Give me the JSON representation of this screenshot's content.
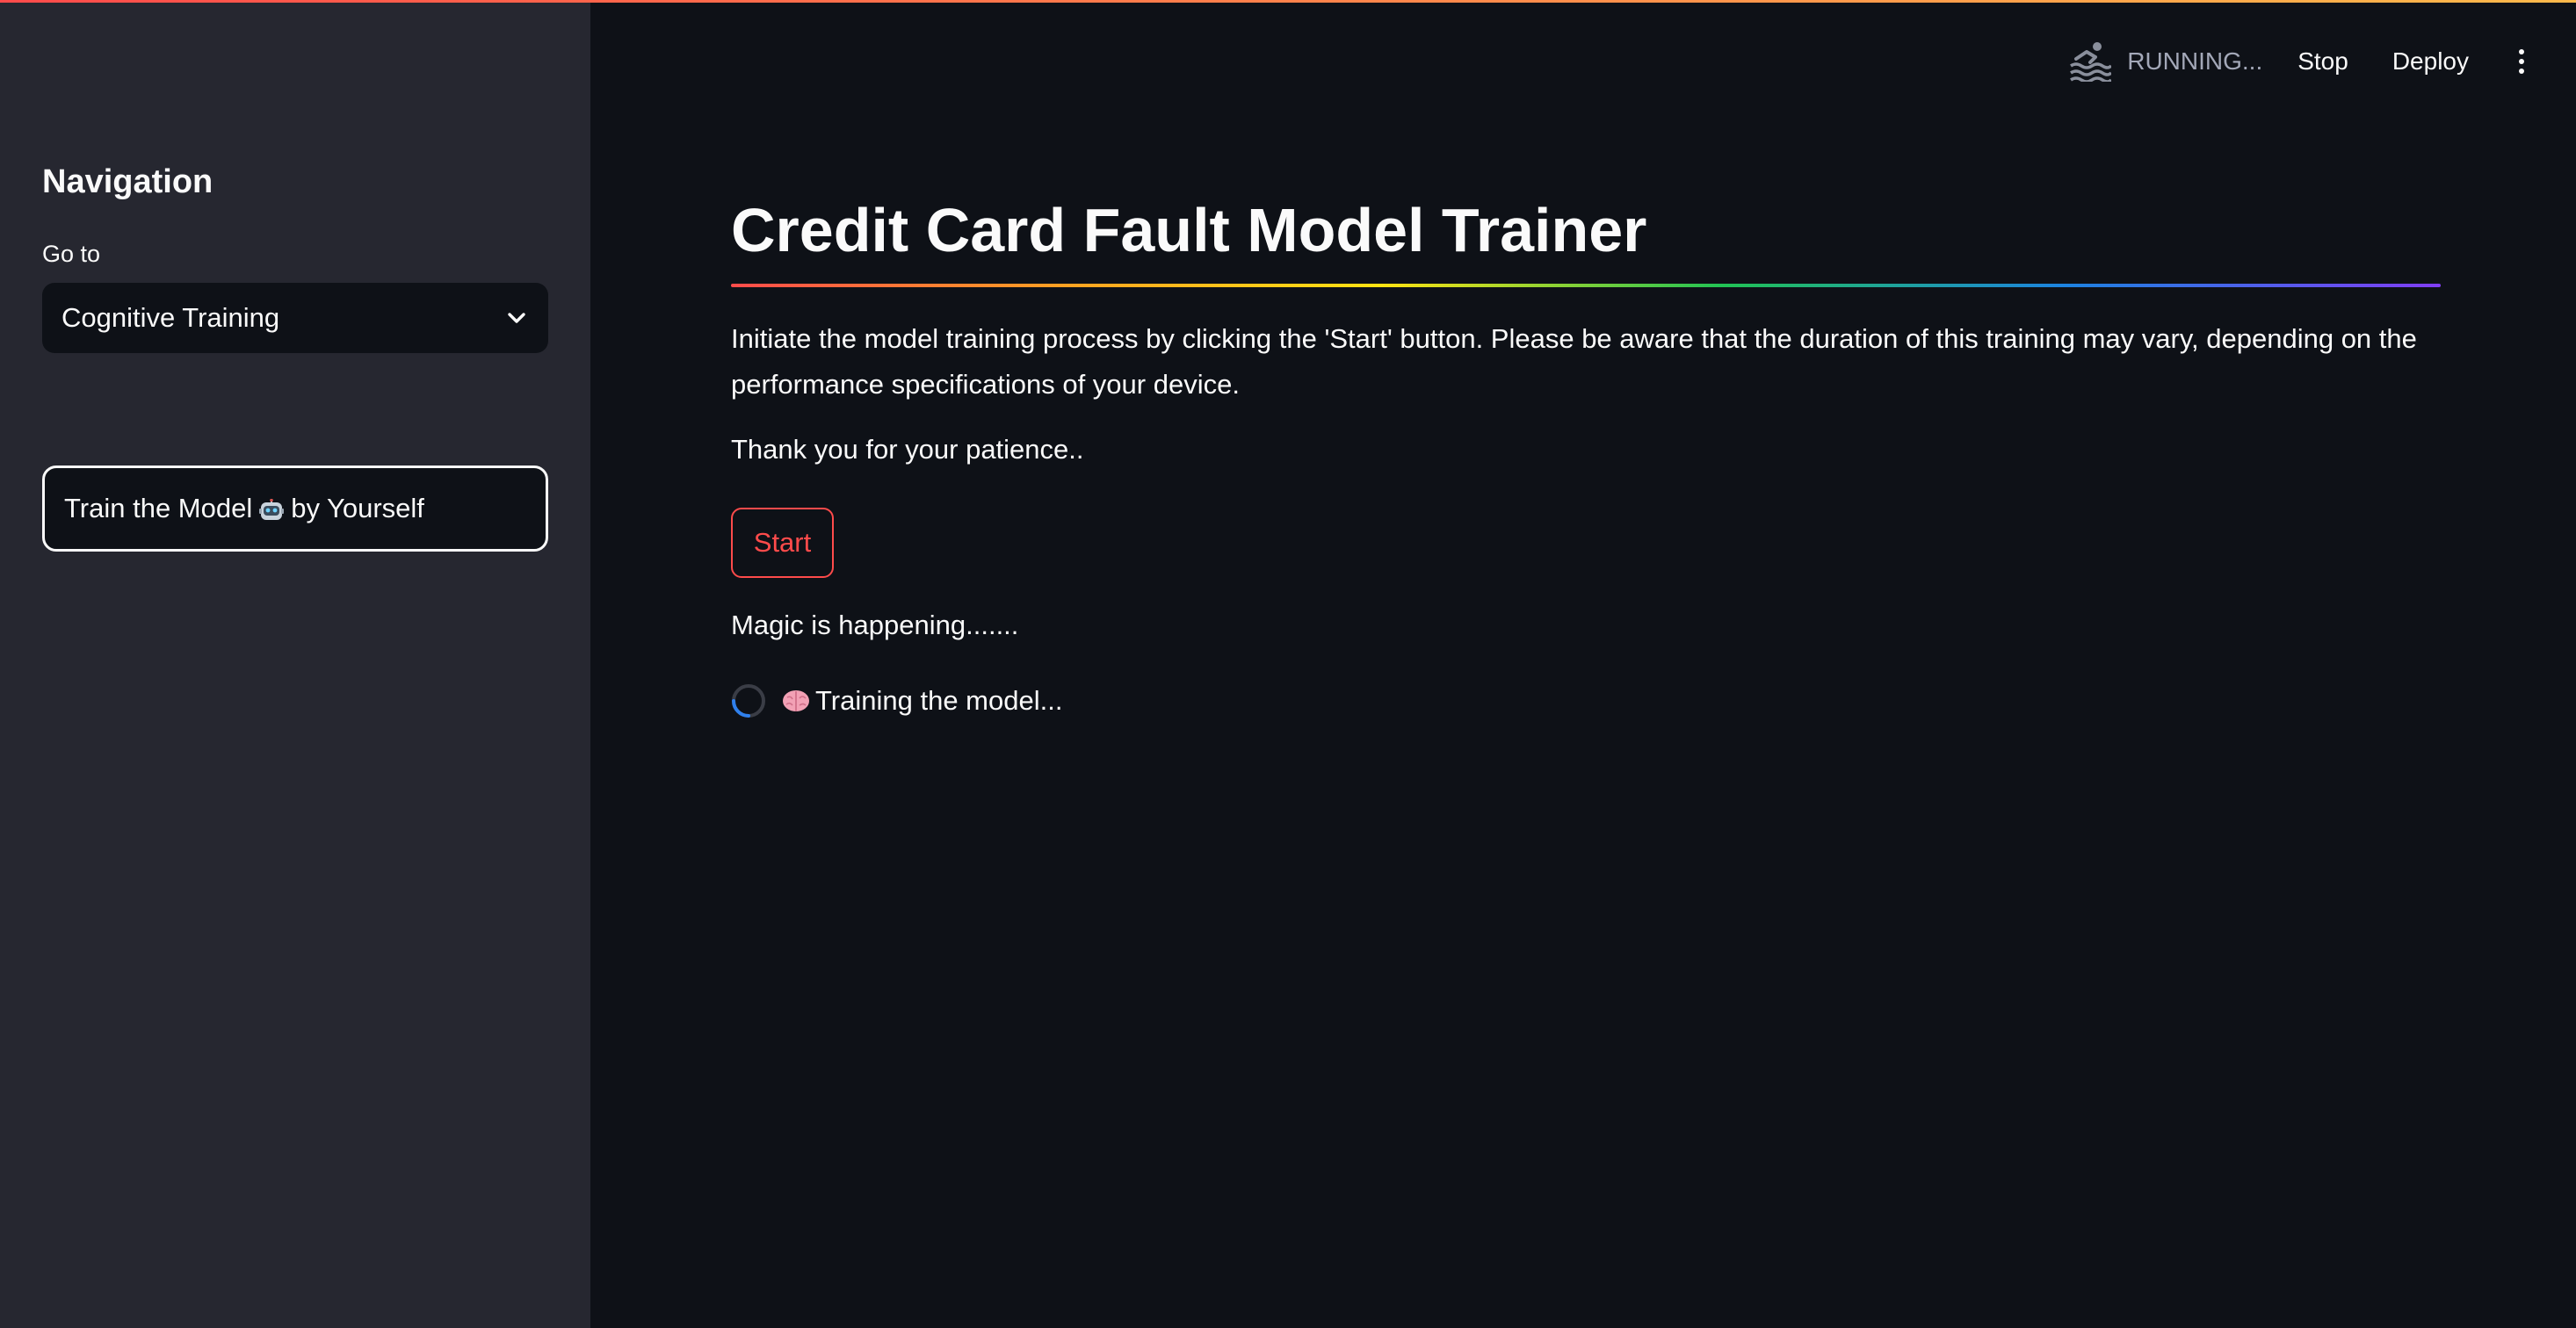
{
  "sidebar": {
    "title": "Navigation",
    "select_label": "Go to",
    "select_value": "Cognitive Training",
    "train_button_prefix": "Train the Model",
    "train_button_suffix": "by Yourself"
  },
  "toolbar": {
    "status": "RUNNING...",
    "stop_label": "Stop",
    "deploy_label": "Deploy"
  },
  "main": {
    "title": "Credit Card Fault Model Trainer",
    "description": "Initiate the model training process by clicking the 'Start' button. Please be aware that the duration of this training may vary, depending on the performance specifications of your device.",
    "thanks": "Thank you for your patience..",
    "start_label": "Start",
    "magic_text": "Magic is happening.......",
    "spinner_text": "Training the model..."
  },
  "icons": {
    "status": "swimmer-icon",
    "select": "chevron-down-icon",
    "menu": "kebab-menu-icon",
    "train_button": "robot-icon",
    "spinner": "loading-spinner-icon",
    "spinner_emoji": "brain-icon"
  },
  "colors": {
    "background": "#0e1117",
    "sidebar": "#262730",
    "accent": "#ff4b4b",
    "text": "#fafafa",
    "muted": "#a3a8b8"
  }
}
